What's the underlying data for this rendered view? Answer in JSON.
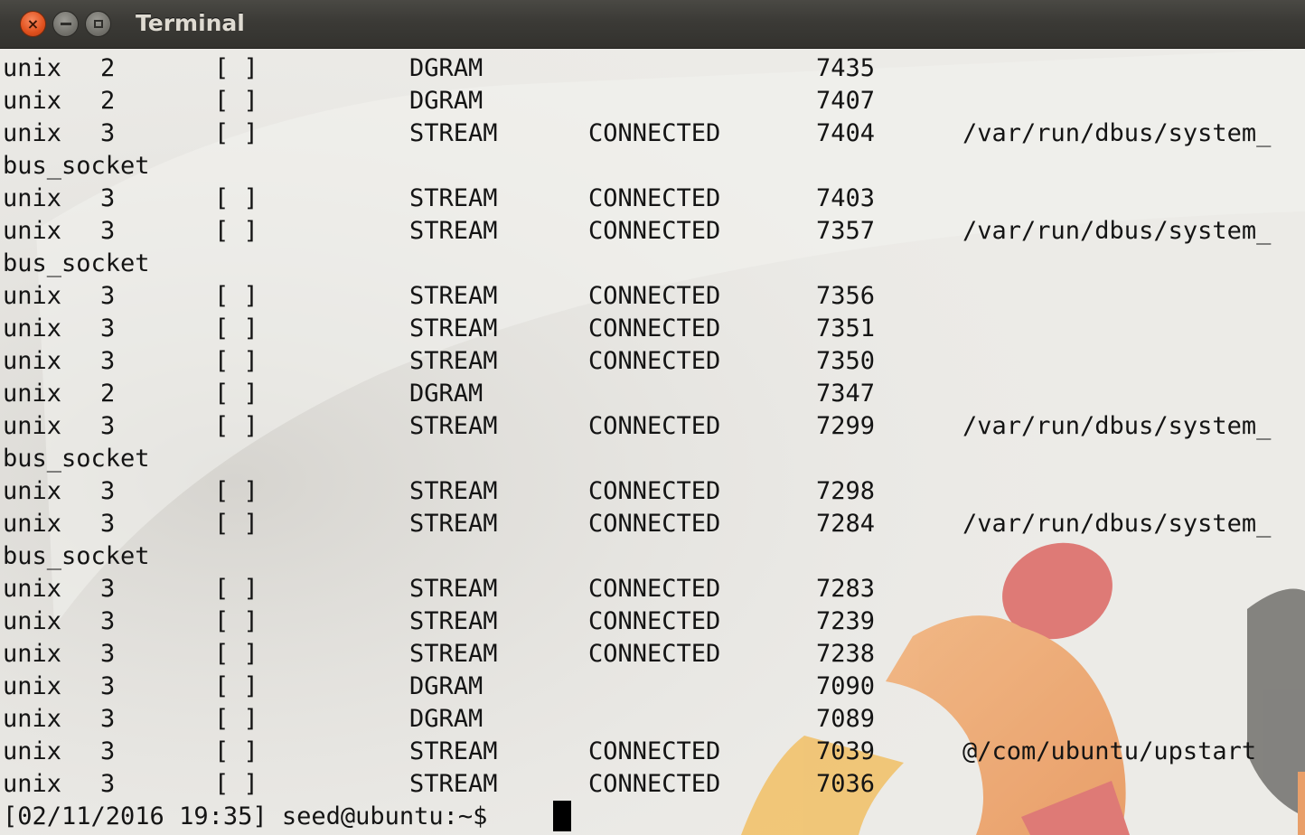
{
  "window": {
    "title": "Terminal",
    "close_glyph": "×",
    "buttons": [
      "close-icon",
      "minimize-icon",
      "maximize-icon"
    ]
  },
  "colors": {
    "background": "#ecebe7",
    "text": "#141414",
    "titlebar": "#3b3a36",
    "close_button": "#e0501d"
  },
  "terminal": {
    "lines": [
      {
        "kind": "row",
        "proto": "unix",
        "refcnt": "2",
        "flags": "[ ]",
        "type": "DGRAM",
        "state": "",
        "inode": "7435",
        "path": ""
      },
      {
        "kind": "row",
        "proto": "unix",
        "refcnt": "2",
        "flags": "[ ]",
        "type": "DGRAM",
        "state": "",
        "inode": "7407",
        "path": ""
      },
      {
        "kind": "row",
        "proto": "unix",
        "refcnt": "3",
        "flags": "[ ]",
        "type": "STREAM",
        "state": "CONNECTED",
        "inode": "7404",
        "path": "/var/run/dbus/system_"
      },
      {
        "kind": "wrap",
        "text": "bus_socket"
      },
      {
        "kind": "row",
        "proto": "unix",
        "refcnt": "3",
        "flags": "[ ]",
        "type": "STREAM",
        "state": "CONNECTED",
        "inode": "7403",
        "path": ""
      },
      {
        "kind": "row",
        "proto": "unix",
        "refcnt": "3",
        "flags": "[ ]",
        "type": "STREAM",
        "state": "CONNECTED",
        "inode": "7357",
        "path": "/var/run/dbus/system_"
      },
      {
        "kind": "wrap",
        "text": "bus_socket"
      },
      {
        "kind": "row",
        "proto": "unix",
        "refcnt": "3",
        "flags": "[ ]",
        "type": "STREAM",
        "state": "CONNECTED",
        "inode": "7356",
        "path": ""
      },
      {
        "kind": "row",
        "proto": "unix",
        "refcnt": "3",
        "flags": "[ ]",
        "type": "STREAM",
        "state": "CONNECTED",
        "inode": "7351",
        "path": ""
      },
      {
        "kind": "row",
        "proto": "unix",
        "refcnt": "3",
        "flags": "[ ]",
        "type": "STREAM",
        "state": "CONNECTED",
        "inode": "7350",
        "path": ""
      },
      {
        "kind": "row",
        "proto": "unix",
        "refcnt": "2",
        "flags": "[ ]",
        "type": "DGRAM",
        "state": "",
        "inode": "7347",
        "path": ""
      },
      {
        "kind": "row",
        "proto": "unix",
        "refcnt": "3",
        "flags": "[ ]",
        "type": "STREAM",
        "state": "CONNECTED",
        "inode": "7299",
        "path": "/var/run/dbus/system_"
      },
      {
        "kind": "wrap",
        "text": "bus_socket"
      },
      {
        "kind": "row",
        "proto": "unix",
        "refcnt": "3",
        "flags": "[ ]",
        "type": "STREAM",
        "state": "CONNECTED",
        "inode": "7298",
        "path": ""
      },
      {
        "kind": "row",
        "proto": "unix",
        "refcnt": "3",
        "flags": "[ ]",
        "type": "STREAM",
        "state": "CONNECTED",
        "inode": "7284",
        "path": "/var/run/dbus/system_"
      },
      {
        "kind": "wrap",
        "text": "bus_socket"
      },
      {
        "kind": "row",
        "proto": "unix",
        "refcnt": "3",
        "flags": "[ ]",
        "type": "STREAM",
        "state": "CONNECTED",
        "inode": "7283",
        "path": ""
      },
      {
        "kind": "row",
        "proto": "unix",
        "refcnt": "3",
        "flags": "[ ]",
        "type": "STREAM",
        "state": "CONNECTED",
        "inode": "7239",
        "path": ""
      },
      {
        "kind": "row",
        "proto": "unix",
        "refcnt": "3",
        "flags": "[ ]",
        "type": "STREAM",
        "state": "CONNECTED",
        "inode": "7238",
        "path": ""
      },
      {
        "kind": "row",
        "proto": "unix",
        "refcnt": "3",
        "flags": "[ ]",
        "type": "DGRAM",
        "state": "",
        "inode": "7090",
        "path": ""
      },
      {
        "kind": "row",
        "proto": "unix",
        "refcnt": "3",
        "flags": "[ ]",
        "type": "DGRAM",
        "state": "",
        "inode": "7089",
        "path": ""
      },
      {
        "kind": "row",
        "proto": "unix",
        "refcnt": "3",
        "flags": "[ ]",
        "type": "STREAM",
        "state": "CONNECTED",
        "inode": "7039",
        "path": "@/com/ubuntu/upstart"
      },
      {
        "kind": "row",
        "proto": "unix",
        "refcnt": "3",
        "flags": "[ ]",
        "type": "STREAM",
        "state": "CONNECTED",
        "inode": "7036",
        "path": ""
      }
    ],
    "prompt": "[02/11/2016 19:35] seed@ubuntu:~$ "
  }
}
